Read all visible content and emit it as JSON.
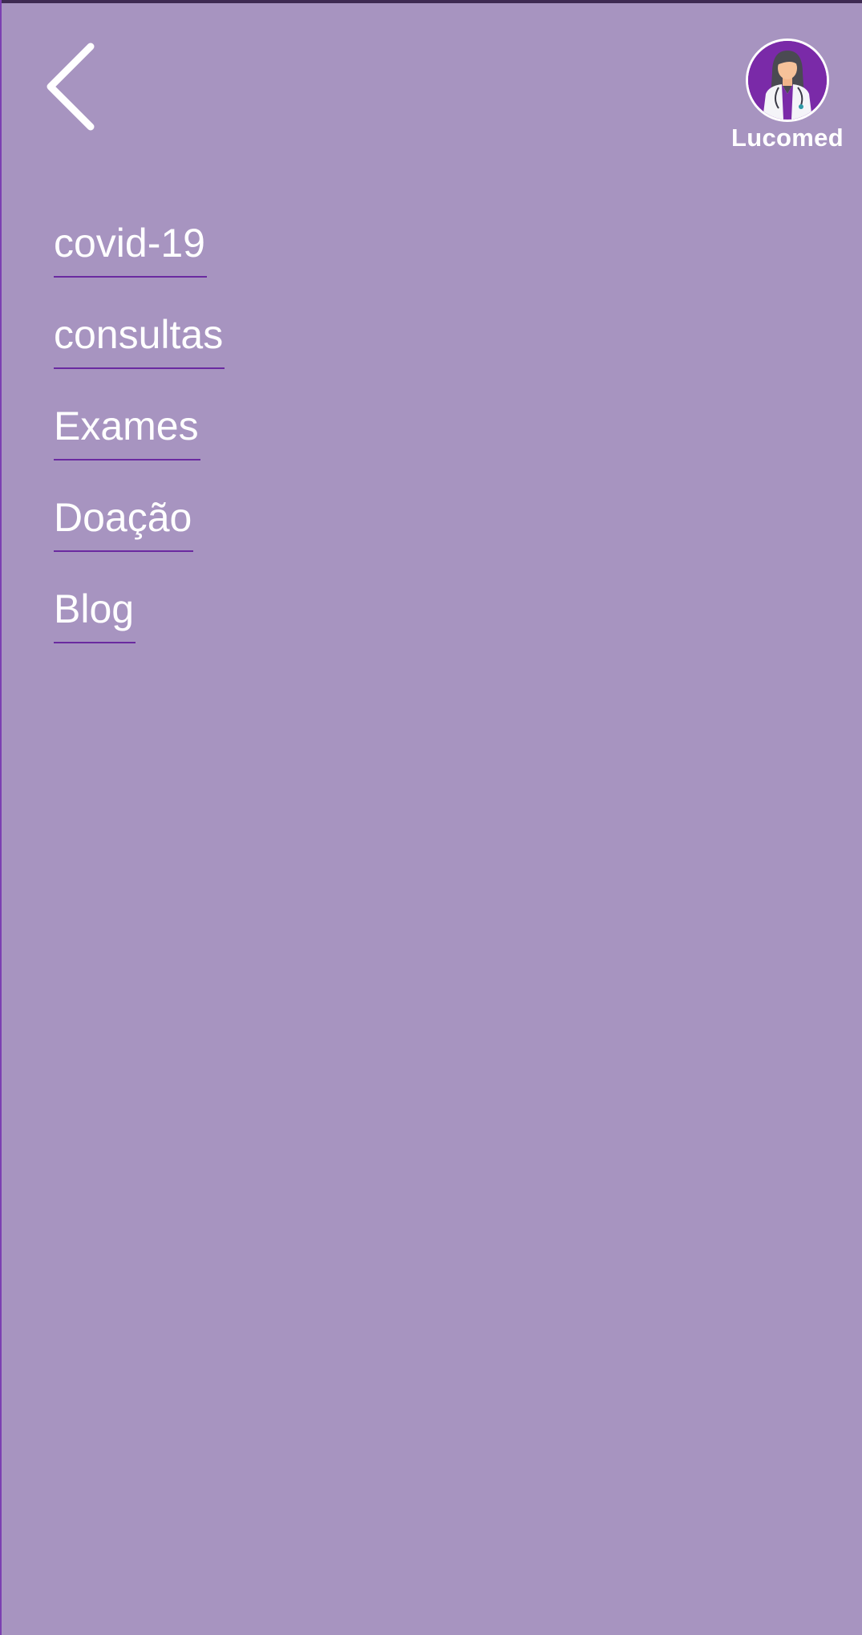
{
  "header": {
    "back_icon": "chevron-left-icon",
    "brand_name": "Lucomed",
    "avatar_icon": "doctor-avatar-icon"
  },
  "menu": {
    "items": [
      {
        "label": "covid-19"
      },
      {
        "label": "consultas"
      },
      {
        "label": "Exames"
      },
      {
        "label": "Doação"
      },
      {
        "label": "Blog"
      }
    ]
  },
  "colors": {
    "background": "#a794c0",
    "accent": "#7a2aa8",
    "underline": "#6a2aa0",
    "text": "#ffffff"
  }
}
